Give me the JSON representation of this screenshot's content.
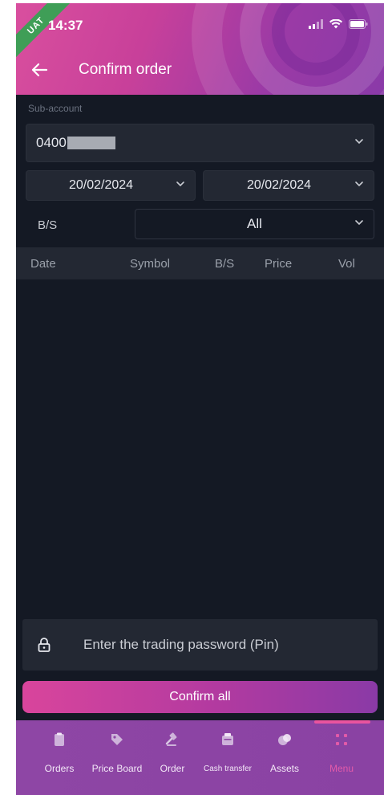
{
  "status_bar": {
    "time": "14:37",
    "badge": "UAT"
  },
  "header": {
    "title": "Confirm order"
  },
  "filters": {
    "sub_account_label": "Sub-account",
    "sub_account_value": "0400",
    "from_date": "20/02/2024",
    "to_date": "20/02/2024",
    "bs_label": "B/S",
    "bs_value": "All"
  },
  "table": {
    "columns": [
      "Date",
      "Symbol",
      "B/S",
      "Price",
      "Vol"
    ]
  },
  "pin": {
    "placeholder": "Enter the trading password (Pin)"
  },
  "confirm_label": "Confirm all",
  "nav": {
    "items": [
      {
        "label": "Orders",
        "icon": "clipboard-icon"
      },
      {
        "label": "Price Board",
        "icon": "tag-icon"
      },
      {
        "label": "Order",
        "icon": "gavel-icon"
      },
      {
        "label": "Cash transfer",
        "icon": "wallet-icon"
      },
      {
        "label": "Assets",
        "icon": "coins-icon"
      },
      {
        "label": "Menu",
        "icon": "grid-icon"
      }
    ],
    "active": "Menu"
  },
  "colors": {
    "accent": "#e25aa9",
    "background": "#141924",
    "panel": "#232833",
    "nav": "#8e46a5"
  }
}
